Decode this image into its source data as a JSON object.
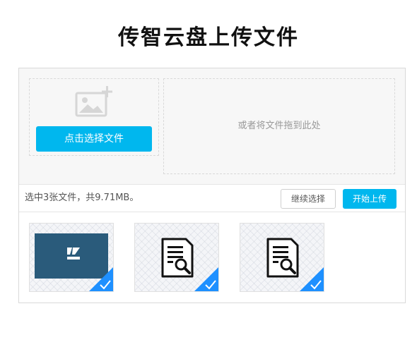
{
  "title": "传智云盘上传文件",
  "picker": {
    "button_label": "点击选择文件",
    "drop_hint": "或者将文件拖到此处"
  },
  "status": {
    "summary": "选中3张文件，共9.71MB。",
    "continue_label": "继续选择",
    "upload_label": "开始上传"
  },
  "files": [
    {
      "type": "image",
      "logo_text": "CAST",
      "selected": true
    },
    {
      "type": "document",
      "selected": true
    },
    {
      "type": "document",
      "selected": true
    }
  ],
  "colors": {
    "accent": "#00b7ee",
    "image_preview": "#2a5b7b",
    "check_badge": "#1e90ff"
  }
}
